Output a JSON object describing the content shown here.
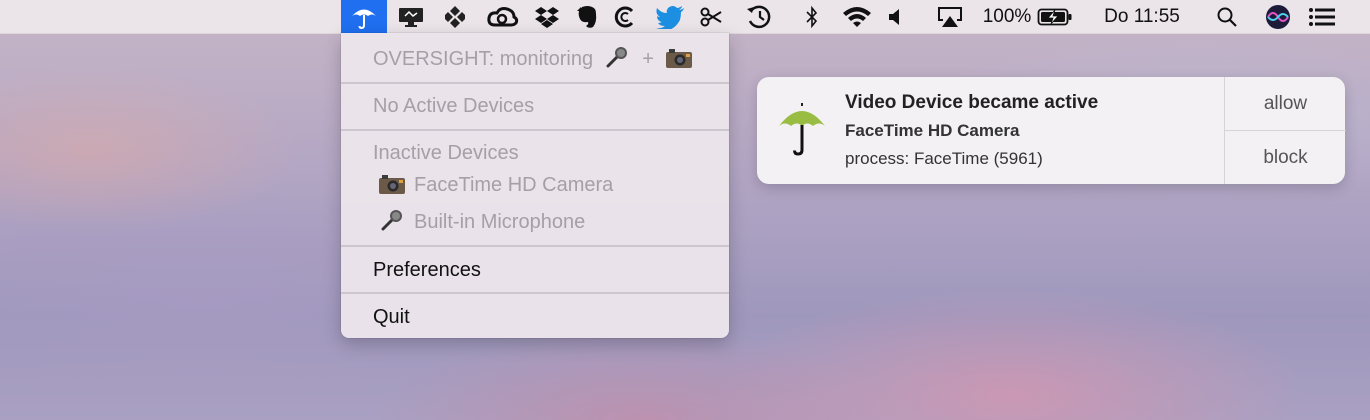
{
  "menubar": {
    "battery_percent": "100%",
    "clock": "Do 11:55",
    "icons": [
      "umbrella-icon",
      "monitor-icon",
      "dropbox-like-icon",
      "creative-cloud-icon",
      "dropbox-icon",
      "evernote-icon",
      "copyclip-icon",
      "twitter-icon",
      "scissors-icon",
      "time-machine-icon",
      "bluetooth-icon",
      "wifi-icon",
      "volume-icon",
      "airplay-icon",
      "battery-icon",
      "search-icon",
      "siri-icon",
      "notification-center-icon"
    ]
  },
  "dropdown": {
    "header": "OVERSIGHT: monitoring",
    "header_plus": "+",
    "no_active": "No Active Devices",
    "inactive_header": "Inactive Devices",
    "inactive_devices": [
      "FaceTime HD Camera",
      "Built-in Microphone"
    ],
    "preferences": "Preferences",
    "quit": "Quit"
  },
  "notification": {
    "title": "Video Device became active",
    "device": "FaceTime HD Camera",
    "process": "process: FaceTime (5961)",
    "allow_label": "allow",
    "block_label": "block",
    "icon_color": "#99bd42"
  }
}
